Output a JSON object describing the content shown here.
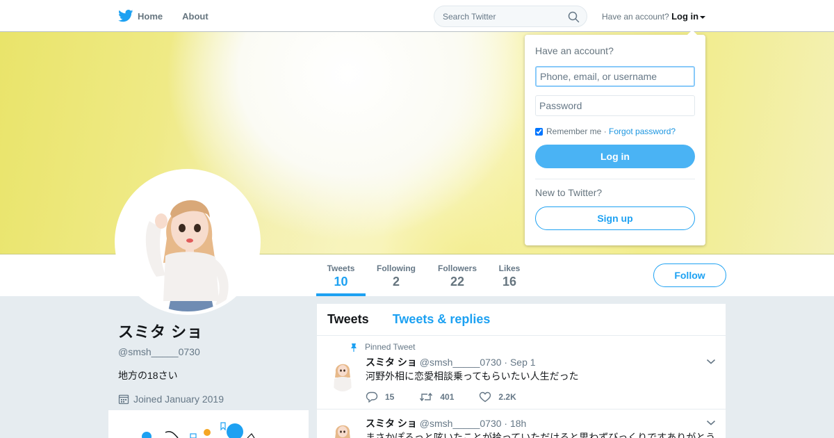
{
  "nav": {
    "home_label": "Home",
    "about_label": "About",
    "search_placeholder": "Search Twitter",
    "have_account": "Have an account?",
    "login_label": "Log in"
  },
  "profile": {
    "name": "スミタ ショ",
    "handle": "@smsh_____0730",
    "bio": "地方の18さい",
    "joined": "Joined January 2019"
  },
  "stats": [
    {
      "label": "Tweets",
      "value": "10"
    },
    {
      "label": "Following",
      "value": "2"
    },
    {
      "label": "Followers",
      "value": "22"
    },
    {
      "label": "Likes",
      "value": "16"
    }
  ],
  "follow_label": "Follow",
  "timeline": {
    "tabs": [
      "Tweets",
      "Tweets & replies"
    ],
    "tweets": [
      {
        "pinned_label": "Pinned Tweet",
        "name": "スミタ ショ",
        "handle": "@smsh_____0730",
        "time": "· Sep 1",
        "text": "河野外相に恋愛相談乗ってもらいたい人生だった",
        "replies": "15",
        "retweets": "401",
        "likes": "2.2K"
      },
      {
        "name": "スミタ ショ",
        "handle": "@smsh_____0730",
        "time": "· 18h",
        "text": "まさかぽろっと呟いたことが拾っていただけると思わずびっくりですありがとう"
      }
    ]
  },
  "login_dropdown": {
    "title": "Have an account?",
    "username_placeholder": "Phone, email, or username",
    "password_placeholder": "Password",
    "remember_label": "Remember me ·",
    "forgot_label": "Forgot password?",
    "login_button": "Log in",
    "new_label": "New to Twitter?",
    "signup_button": "Sign up"
  },
  "colors": {
    "brand_blue": "#1da1f2",
    "banner_yellow": "#efea86"
  },
  "icons": [
    "twitter-bird-icon",
    "search-icon",
    "calendar-icon",
    "pin-icon",
    "reply-icon",
    "retweet-icon",
    "heart-icon",
    "chevron-down-icon"
  ]
}
